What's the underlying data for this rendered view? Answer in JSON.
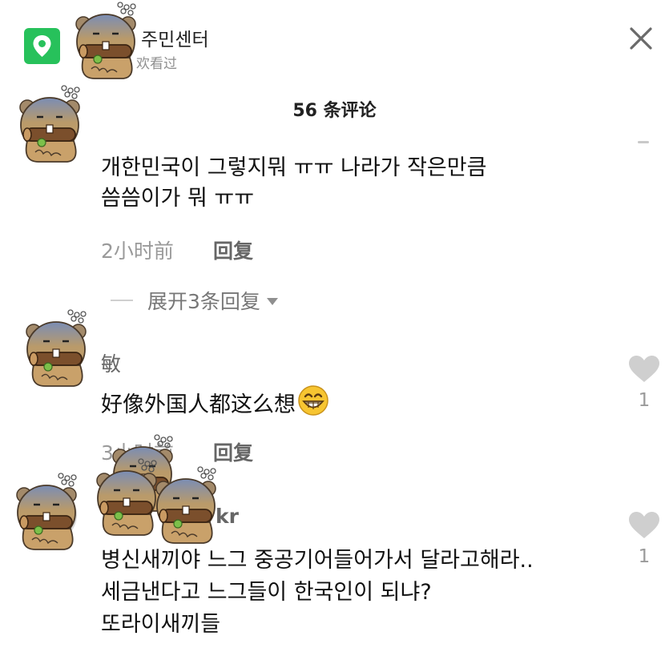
{
  "header": {
    "title": "주민센터",
    "subtitle": "欢看过",
    "location_icon": "location-pin-icon",
    "close_icon": "close-icon"
  },
  "comments_title": "56 条评论",
  "comments": [
    {
      "author": "",
      "text_lines": [
        "개한민국이 그렇지뭐 ㅠㅠ 나라가 작은만큼",
        "씀씀이가 뭐 ㅠㅠ"
      ],
      "time": "2小时前",
      "reply_label": "回复",
      "expand_label": "展开3条回复"
    },
    {
      "author": "敏",
      "text_lines": [
        "好像外国人都这么想"
      ],
      "emoji": "grinning-face-icon",
      "time": "3小时前",
      "reply_label": "回复",
      "likes": "1"
    },
    {
      "author": "kr",
      "text_lines": [
        "병신새끼야 느그 중공기어들어가서 달라고해라..",
        "세금낸다고 느그들이 한국인이 되냐?",
        "또라이새끼들"
      ],
      "likes": "1"
    }
  ],
  "colors": {
    "accent_green": "#27c15b",
    "heart_gray": "#cfcfcf",
    "meta_gray": "#9a9a9a"
  },
  "stickers": "beaver-sticker-icon"
}
